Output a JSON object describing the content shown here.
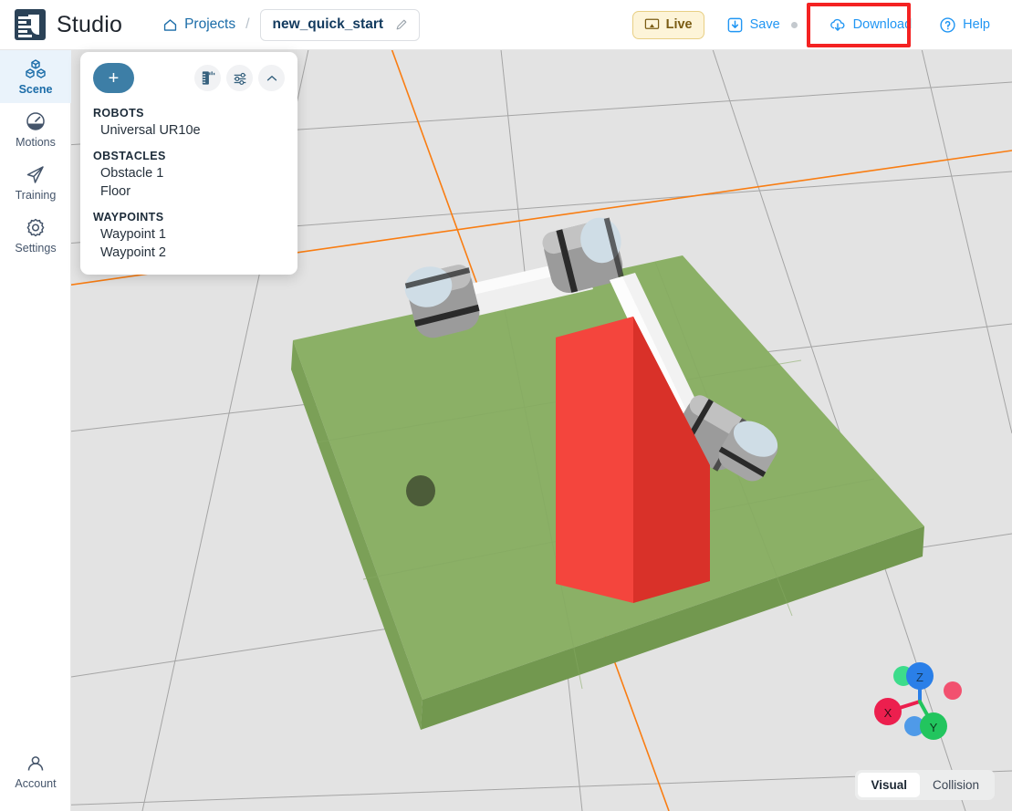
{
  "header": {
    "logo_text": "Studio",
    "logo_icon": "studio-logo-icon",
    "breadcrumb": {
      "home_icon": "home-icon",
      "projects_label": "Projects",
      "separator": "/"
    },
    "project": {
      "name": "new_quick_start",
      "edit_icon": "pencil-icon"
    },
    "toolbar": {
      "live_label": "Live",
      "live_icon": "monitor-icon",
      "save_label": "Save",
      "save_icon": "save-tray-icon",
      "save_has_changes_dot": true,
      "download_label": "Download",
      "download_icon": "cloud-download-icon",
      "help_label": "Help",
      "help_icon": "question-circle-icon"
    }
  },
  "annotation": {
    "target": "download-button",
    "color": "#f42222"
  },
  "sidebar": {
    "items": [
      {
        "label": "Scene",
        "icon": "cubes-icon",
        "active": true
      },
      {
        "label": "Motions",
        "icon": "gauge-icon",
        "active": false
      },
      {
        "label": "Training",
        "icon": "paper-plane-icon",
        "active": false
      },
      {
        "label": "Settings",
        "icon": "gear-icon",
        "active": false
      }
    ],
    "account": {
      "label": "Account",
      "icon": "person-icon"
    }
  },
  "scene_panel": {
    "add_label": "+",
    "icons": [
      {
        "name": "ruler-icon"
      },
      {
        "name": "sliders-icon"
      },
      {
        "name": "chevron-up-icon"
      }
    ],
    "groups": [
      {
        "title": "ROBOTS",
        "items": [
          "Universal UR10e"
        ]
      },
      {
        "title": "OBSTACLES",
        "items": [
          "Obstacle 1",
          "Floor"
        ]
      },
      {
        "title": "WAYPOINTS",
        "items": [
          "Waypoint 1",
          "Waypoint 2"
        ]
      }
    ]
  },
  "viewport": {
    "background_color": "#e3e3e3",
    "grid_color": "#9a9a9a",
    "axis_color": "#f97d12",
    "floor_color": "#8bb066",
    "obstacle_color": "#ef3b34",
    "gizmo": {
      "x_label": "X",
      "y_label": "Y",
      "z_label": "Z",
      "x_color": "#ec1f4e",
      "y_color": "#22c55e",
      "z_color": "#2a7fe8"
    },
    "display_modes": [
      {
        "label": "Visual",
        "selected": true
      },
      {
        "label": "Collision",
        "selected": false
      }
    ]
  }
}
